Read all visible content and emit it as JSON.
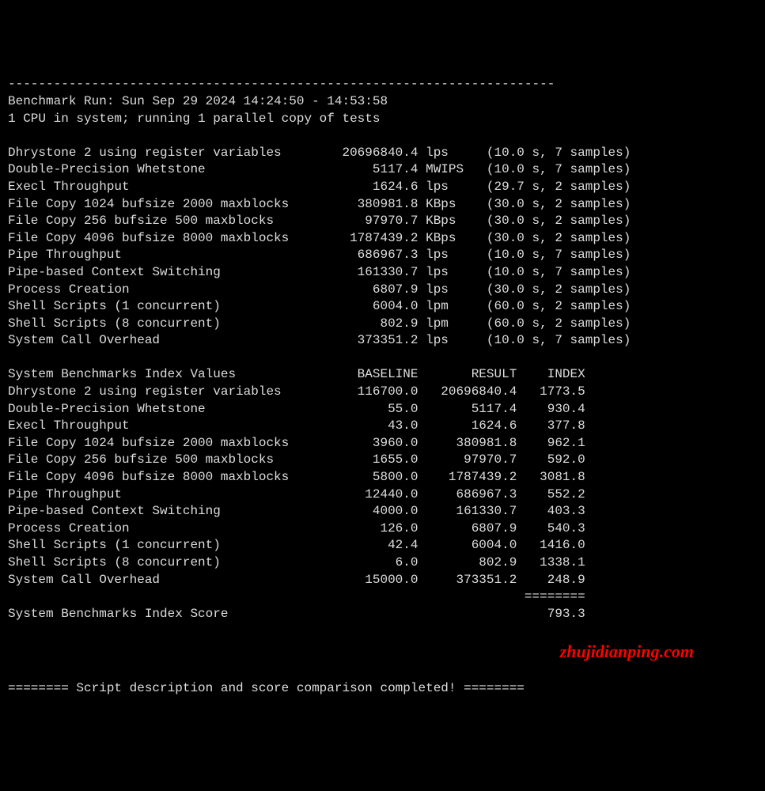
{
  "rule": "------------------------------------------------------------------------",
  "header": {
    "run_label": "Benchmark Run:",
    "run_time": "Sun Sep 29 2024 14:24:50 - 14:53:58",
    "sysinfo": "1 CPU in system; running 1 parallel copy of tests"
  },
  "raw": [
    {
      "name": "Dhrystone 2 using register variables",
      "value": "20696840.4",
      "unit": "lps",
      "extra": "(10.0 s, 7 samples)"
    },
    {
      "name": "Double-Precision Whetstone",
      "value": "5117.4",
      "unit": "MWIPS",
      "extra": "(10.0 s, 7 samples)"
    },
    {
      "name": "Execl Throughput",
      "value": "1624.6",
      "unit": "lps",
      "extra": "(29.7 s, 2 samples)"
    },
    {
      "name": "File Copy 1024 bufsize 2000 maxblocks",
      "value": "380981.8",
      "unit": "KBps",
      "extra": "(30.0 s, 2 samples)"
    },
    {
      "name": "File Copy 256 bufsize 500 maxblocks",
      "value": "97970.7",
      "unit": "KBps",
      "extra": "(30.0 s, 2 samples)"
    },
    {
      "name": "File Copy 4096 bufsize 8000 maxblocks",
      "value": "1787439.2",
      "unit": "KBps",
      "extra": "(30.0 s, 2 samples)"
    },
    {
      "name": "Pipe Throughput",
      "value": "686967.3",
      "unit": "lps",
      "extra": "(10.0 s, 7 samples)"
    },
    {
      "name": "Pipe-based Context Switching",
      "value": "161330.7",
      "unit": "lps",
      "extra": "(10.0 s, 7 samples)"
    },
    {
      "name": "Process Creation",
      "value": "6807.9",
      "unit": "lps",
      "extra": "(30.0 s, 2 samples)"
    },
    {
      "name": "Shell Scripts (1 concurrent)",
      "value": "6004.0",
      "unit": "lpm",
      "extra": "(60.0 s, 2 samples)"
    },
    {
      "name": "Shell Scripts (8 concurrent)",
      "value": "802.9",
      "unit": "lpm",
      "extra": "(60.0 s, 2 samples)"
    },
    {
      "name": "System Call Overhead",
      "value": "373351.2",
      "unit": "lps",
      "extra": "(10.0 s, 7 samples)"
    }
  ],
  "index_table": {
    "head": {
      "name": "System Benchmarks Index Values",
      "baseline": "BASELINE",
      "result": "RESULT",
      "index": "INDEX"
    },
    "rows": [
      {
        "name": "Dhrystone 2 using register variables",
        "baseline": "116700.0",
        "result": "20696840.4",
        "index": "1773.5"
      },
      {
        "name": "Double-Precision Whetstone",
        "baseline": "55.0",
        "result": "5117.4",
        "index": "930.4"
      },
      {
        "name": "Execl Throughput",
        "baseline": "43.0",
        "result": "1624.6",
        "index": "377.8"
      },
      {
        "name": "File Copy 1024 bufsize 2000 maxblocks",
        "baseline": "3960.0",
        "result": "380981.8",
        "index": "962.1"
      },
      {
        "name": "File Copy 256 bufsize 500 maxblocks",
        "baseline": "1655.0",
        "result": "97970.7",
        "index": "592.0"
      },
      {
        "name": "File Copy 4096 bufsize 8000 maxblocks",
        "baseline": "5800.0",
        "result": "1787439.2",
        "index": "3081.8"
      },
      {
        "name": "Pipe Throughput",
        "baseline": "12440.0",
        "result": "686967.3",
        "index": "552.2"
      },
      {
        "name": "Pipe-based Context Switching",
        "baseline": "4000.0",
        "result": "161330.7",
        "index": "403.3"
      },
      {
        "name": "Process Creation",
        "baseline": "126.0",
        "result": "6807.9",
        "index": "540.3"
      },
      {
        "name": "Shell Scripts (1 concurrent)",
        "baseline": "42.4",
        "result": "6004.0",
        "index": "1416.0"
      },
      {
        "name": "Shell Scripts (8 concurrent)",
        "baseline": "6.0",
        "result": "802.9",
        "index": "1338.1"
      },
      {
        "name": "System Call Overhead",
        "baseline": "15000.0",
        "result": "373351.2",
        "index": "248.9"
      }
    ],
    "score_rule": "========",
    "score_label": "System Benchmarks Index Score",
    "score_value": "793.3"
  },
  "footer": "======== Script description and score comparison completed! ========",
  "watermark": "zhujidianping.com"
}
